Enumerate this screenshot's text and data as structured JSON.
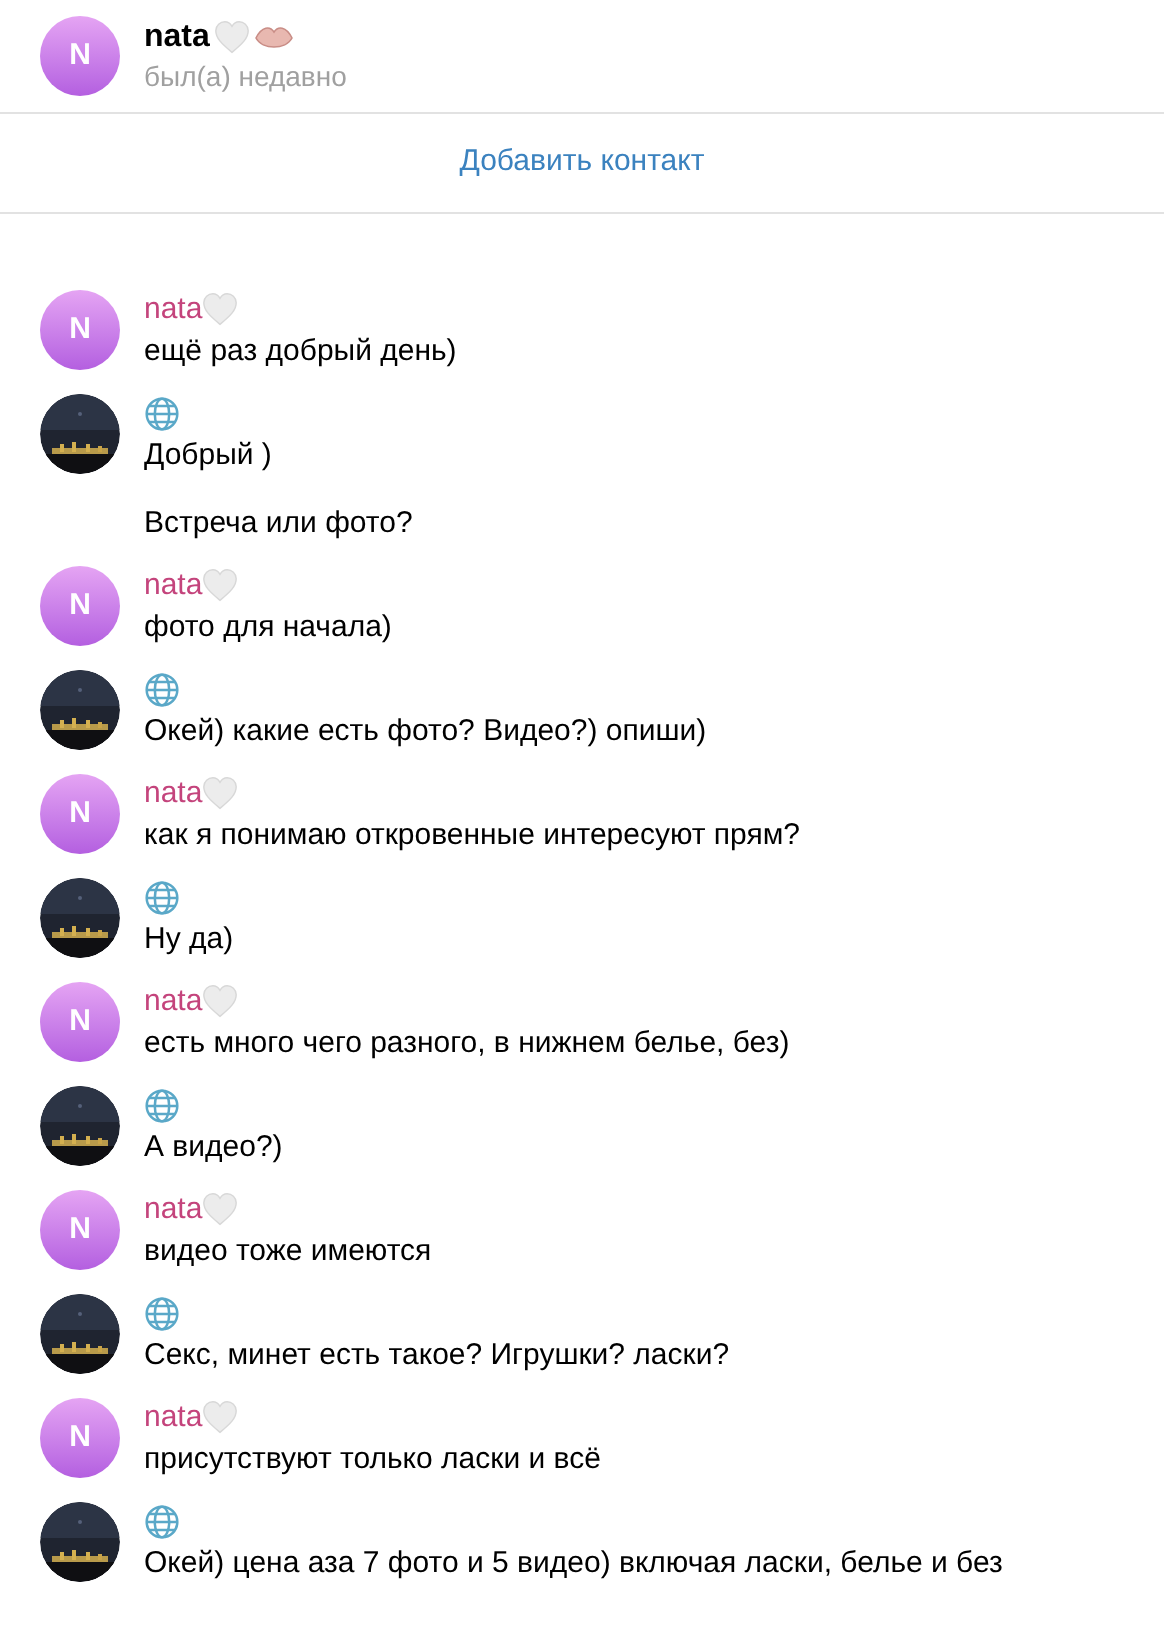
{
  "header": {
    "avatar_letter": "N",
    "name": "nata",
    "status": "был(а) недавно"
  },
  "add_contact": "Добавить контакт",
  "groups": [
    {
      "kind": "nata",
      "avatar_letter": "N",
      "name": "nata",
      "messages": [
        "ещё раз добрый день)"
      ]
    },
    {
      "kind": "globe",
      "messages": [
        "Добрый )",
        "Встреча или фото?"
      ]
    },
    {
      "kind": "nata",
      "avatar_letter": "N",
      "name": "nata",
      "messages": [
        "фото для начала)"
      ]
    },
    {
      "kind": "globe",
      "messages": [
        "Окей) какие есть фото? Видео?) опиши)"
      ]
    },
    {
      "kind": "nata",
      "avatar_letter": "N",
      "name": "nata",
      "messages": [
        "как я понимаю откровенные интересуют прям?"
      ]
    },
    {
      "kind": "globe",
      "messages": [
        "Ну да)"
      ]
    },
    {
      "kind": "nata",
      "avatar_letter": "N",
      "name": "nata",
      "messages": [
        "есть много чего разного, в нижнем белье, без)"
      ]
    },
    {
      "kind": "globe",
      "messages": [
        "А видео?)"
      ]
    },
    {
      "kind": "nata",
      "avatar_letter": "N",
      "name": "nata",
      "messages": [
        "видео тоже имеются"
      ]
    },
    {
      "kind": "globe",
      "messages": [
        "Секс, минет есть такое? Игрушки? ласки?"
      ]
    },
    {
      "kind": "nata",
      "avatar_letter": "N",
      "name": "nata",
      "messages": [
        "присутствуют только ласки и всё"
      ]
    },
    {
      "kind": "globe",
      "messages": [
        "Окей) цена аза 7 фото и 5 видео) включая ласки, белье и без"
      ]
    }
  ]
}
